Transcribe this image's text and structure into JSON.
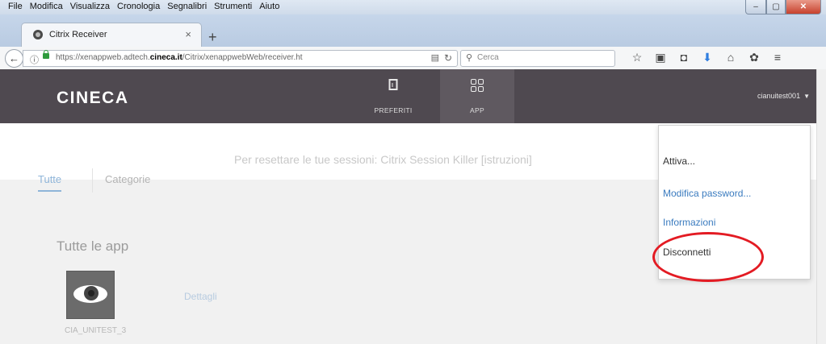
{
  "menubar": {
    "items": [
      "File",
      "Modifica",
      "Visualizza",
      "Cronologia",
      "Segnalibri",
      "Strumenti",
      "Aiuto"
    ]
  },
  "window_controls": {
    "minimize": "–",
    "maximize": "▢",
    "close": "✕"
  },
  "tab": {
    "title": "Citrix Receiver",
    "close": "×",
    "new_tab": "+"
  },
  "navbar": {
    "back": "←",
    "url_prefix": "https://xenappweb.adtech.",
    "url_domain": "cineca.it",
    "url_suffix": "/Citrix/xenappwebWeb/receiver.ht",
    "search_placeholder": "Cerca"
  },
  "header": {
    "logo": "CINECA",
    "tabs": [
      {
        "label": "PREFERITI",
        "icon": "bookmark-icon"
      },
      {
        "label": "APP",
        "icon": "apps-grid-icon"
      }
    ],
    "user": "cianuitest001",
    "user_caret": "▼"
  },
  "content": {
    "subtabs": [
      "Tutte",
      "Categorie"
    ],
    "notice": "Per resettare le tue sessioni: Citrix Session Killer [istruzioni]",
    "section_title": "Tutte le app",
    "app": {
      "name": "CIA_UNITEST_3",
      "details_link": "Dettagli"
    }
  },
  "dropdown": {
    "items": [
      "Attiva...",
      "Modifica password...",
      "Informazioni",
      "Disconnetti"
    ]
  },
  "colors": {
    "header_bg": "#4f4950",
    "link": "#3a7bbf",
    "annotation_ring": "#e31b23"
  }
}
